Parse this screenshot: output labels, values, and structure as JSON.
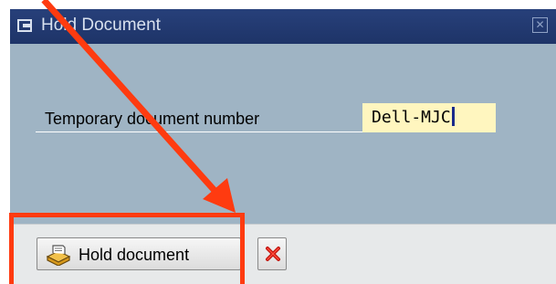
{
  "window": {
    "title": "Hold Document",
    "close_symbol": "✕"
  },
  "form": {
    "label": "Temporary document number",
    "value": "Dell-MJC"
  },
  "footer": {
    "hold_button_label": "Hold document",
    "hold_icon": "printer-hold-icon",
    "cancel_icon": "cancel-x-icon"
  },
  "annotation": {
    "arrow_color": "#ff3b10",
    "box_color": "#ff3b10"
  }
}
